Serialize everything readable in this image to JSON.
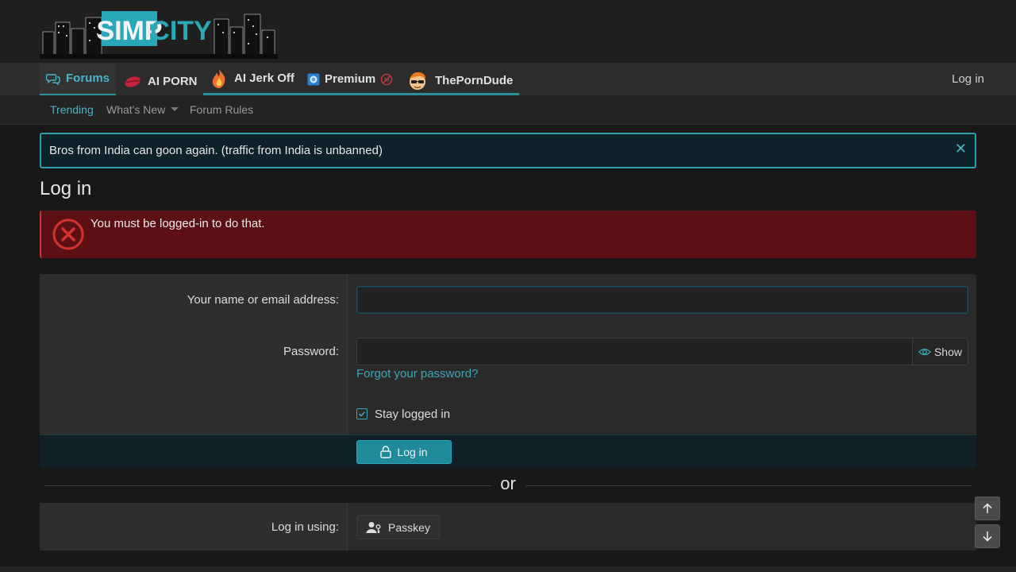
{
  "header": {
    "logo_text": "SIMP CITY"
  },
  "nav": {
    "tabs": [
      {
        "label": "Forums",
        "icon": "chat-bubbles-icon"
      },
      {
        "label": "AI PORN",
        "icon": "lips-icon"
      },
      {
        "label": "AI Jerk Off",
        "icon": "flame-icon"
      },
      {
        "label": "Premium",
        "icon": "premium-badge-icon",
        "suffix_icon": "no-ads-icon"
      },
      {
        "label": "ThePornDude",
        "icon": "dude-avatar-icon"
      }
    ],
    "login_label": "Log in"
  },
  "subnav": {
    "items": [
      {
        "label": "Trending"
      },
      {
        "label": "What's New"
      },
      {
        "label": "Forum Rules"
      }
    ]
  },
  "notice": {
    "text": "Bros from India can goon again. (traffic from India is unbanned)"
  },
  "page": {
    "title": "Log in"
  },
  "error": {
    "message": "You must be logged-in to do that."
  },
  "form": {
    "username_label": "Your name or email address:",
    "username_value": "",
    "password_label": "Password:",
    "password_value": "",
    "show_label": "Show",
    "forgot_label": "Forgot your password?",
    "stay_logged_label": "Stay logged in",
    "stay_logged_checked": true,
    "submit_label": "Log in"
  },
  "divider": {
    "text": "or"
  },
  "alt_login": {
    "label": "Log in using:",
    "passkey_label": "Passkey"
  },
  "colors": {
    "accent": "#2a9fb0",
    "link": "#3ba7b8",
    "error_bg": "#5c1014",
    "notice_bg": "#0e2229"
  }
}
